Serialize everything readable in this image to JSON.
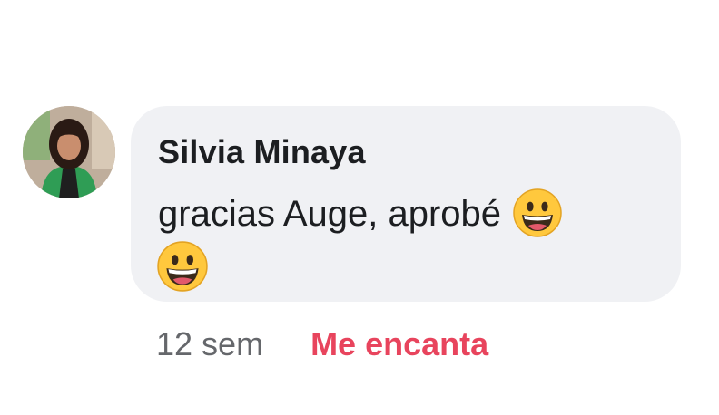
{
  "comment": {
    "author": "Silvia Minaya",
    "text": "gracias Auge, aprobé",
    "emoji": "grinning-face-icon",
    "timestamp": "12 sem",
    "reaction_label": "Me encanta"
  },
  "colors": {
    "bubble": "#f0f1f4",
    "text": "#1c1e21",
    "meta": "#65676b",
    "reaction": "#e8445d",
    "emoji_face": "#ffc83d"
  }
}
